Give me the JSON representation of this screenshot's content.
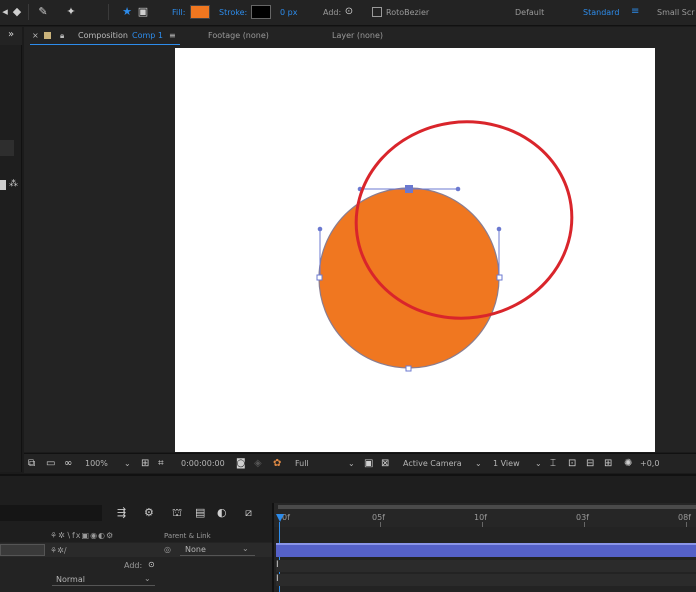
{
  "toolbar": {
    "fill_label": "Fill:",
    "stroke_label": "Stroke:",
    "stroke_width": "0 px",
    "add_label": "Add:",
    "rotobezier_label": "RotoBezier",
    "workspaces": [
      "Default",
      "Standard",
      "Small Scr"
    ],
    "active_workspace": "Standard",
    "fill_color": "#f07720",
    "stroke_color": "#000000",
    "expand_glyph": "»",
    "menu_glyph": "≡"
  },
  "viewer": {
    "tabs": {
      "composition_prefix": "Composition",
      "composition_name": "Comp 1",
      "footage": "Footage (none)",
      "layer": "Layer (none)"
    },
    "canvas_color": "#ffffff",
    "shape_fill": "#f07720",
    "annotation_color": "#d9252b",
    "path_color": "#6b79d0"
  },
  "viewer_bar": {
    "zoom": "100%",
    "timecode": "0:00:00:00",
    "resolution": "Full",
    "camera": "Active Camera",
    "views": "1 View",
    "exposure": "+0,0"
  },
  "timeline": {
    "ruler_labels": [
      "0f",
      "05f",
      "10f",
      "03f",
      "08f"
    ],
    "parent_link_header": "Parent & Link",
    "parent_value": "None",
    "add_label": "Add:",
    "blend_mode": "Normal"
  }
}
